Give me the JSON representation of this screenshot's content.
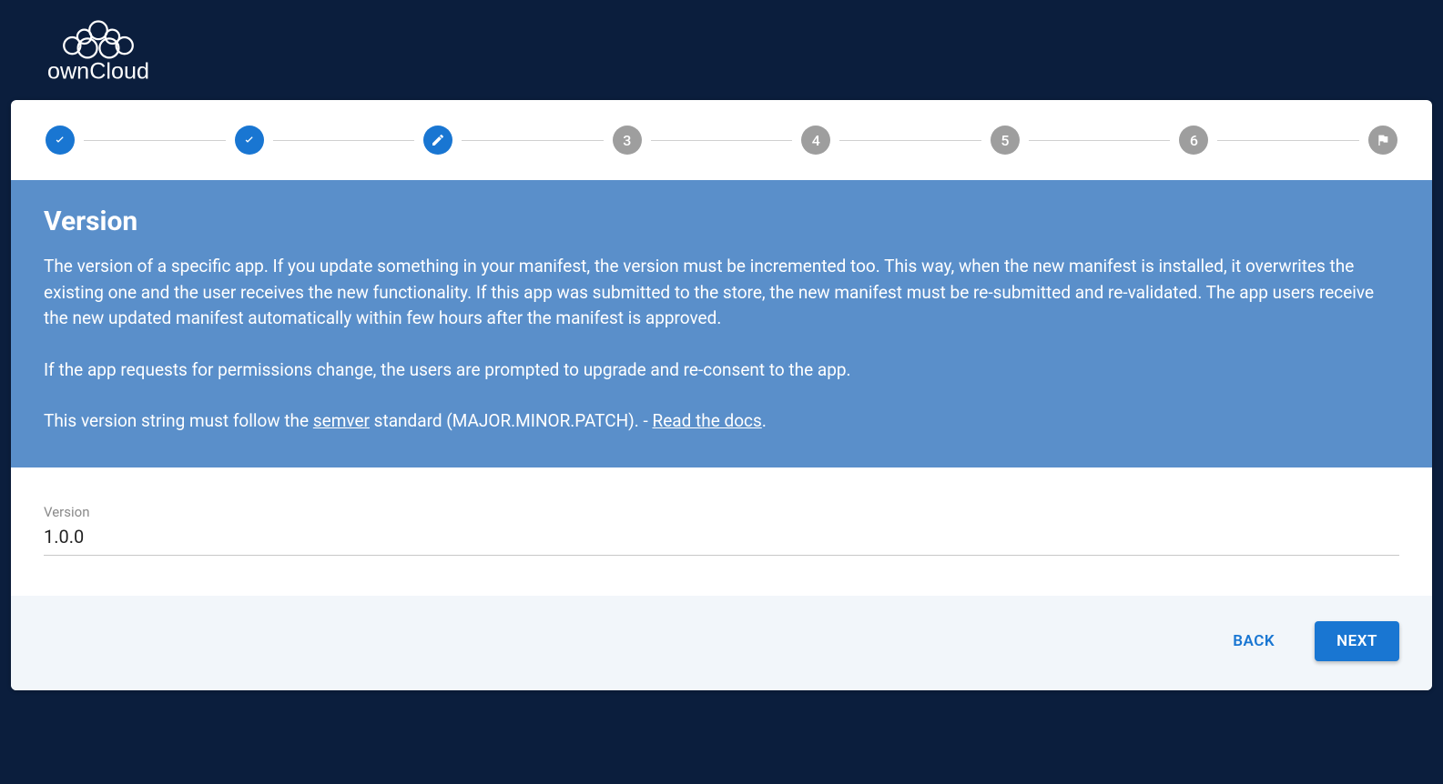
{
  "brand": {
    "name": "ownCloud"
  },
  "stepper": {
    "steps": [
      {
        "state": "done",
        "label": ""
      },
      {
        "state": "done",
        "label": ""
      },
      {
        "state": "current",
        "label": ""
      },
      {
        "state": "future",
        "label": "3"
      },
      {
        "state": "future",
        "label": "4"
      },
      {
        "state": "future",
        "label": "5"
      },
      {
        "state": "future",
        "label": "6"
      },
      {
        "state": "flag",
        "label": ""
      }
    ]
  },
  "panel": {
    "title": "Version",
    "description": "The version of a specific app. If you update something in your manifest, the version must be incremented too. This way, when the new manifest is installed, it overwrites the existing one and the user receives the new functionality. If this app was submitted to the store, the new manifest must be re-submitted and re-validated. The app users receive the new updated manifest automatically within few hours after the manifest is approved.",
    "permissions_note": "If the app requests for permissions change, the users are prompted to upgrade and re-consent to the app.",
    "semver_prefix": "This version string must follow the ",
    "semver_link_text": "semver",
    "semver_mid": " standard (MAJOR.MINOR.PATCH). - ",
    "docs_link_text": "Read the docs",
    "semver_suffix": "."
  },
  "form": {
    "version_label": "Version",
    "version_value": "1.0.0"
  },
  "footer": {
    "back_label": "BACK",
    "next_label": "NEXT"
  }
}
